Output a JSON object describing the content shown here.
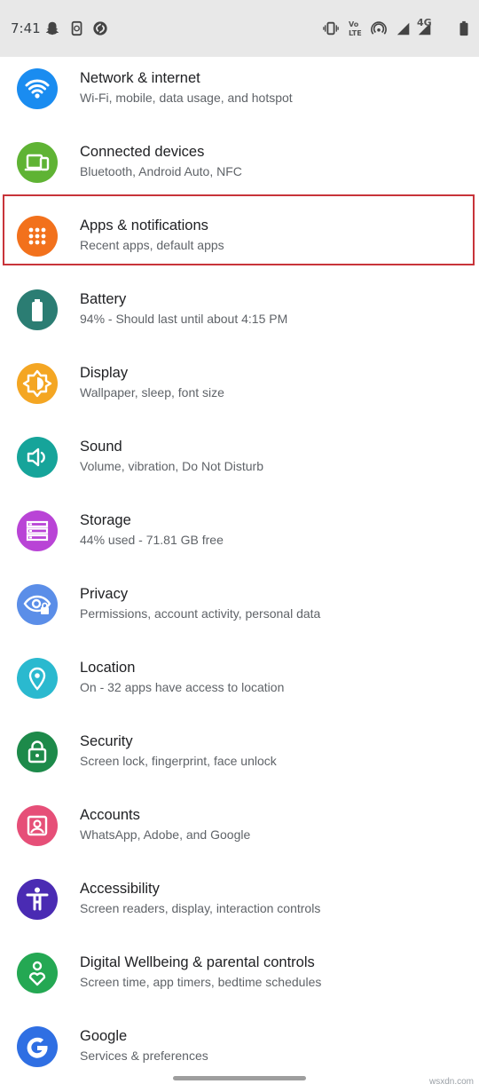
{
  "status_bar": {
    "time": "7:41",
    "left_icons": [
      "snapchat-icon",
      "phone-sync-icon",
      "shazam-icon"
    ],
    "right_icons": [
      "vibrate-icon",
      "volte-icon",
      "hotspot-icon",
      "signal-icon",
      "signal-4g-icon",
      "battery-icon"
    ],
    "volte_label_top": "Vo",
    "volte_label_bottom": "LTE",
    "network_label": "4G"
  },
  "settings": {
    "items": [
      {
        "title": "Network & internet",
        "subtitle": "Wi-Fi, mobile, data usage, and hotspot",
        "icon": "wifi-icon",
        "color": "#1a8cf0"
      },
      {
        "title": "Connected devices",
        "subtitle": "Bluetooth, Android Auto, NFC",
        "icon": "devices-icon",
        "color": "#5fb334"
      },
      {
        "title": "Apps & notifications",
        "subtitle": "Recent apps, default apps",
        "icon": "apps-grid-icon",
        "color": "#f2711c"
      },
      {
        "title": "Battery",
        "subtitle": "94% - Should last until about 4:15 PM",
        "icon": "battery-icon",
        "color": "#2b7d73"
      },
      {
        "title": "Display",
        "subtitle": "Wallpaper, sleep, font size",
        "icon": "brightness-icon",
        "color": "#f4a623"
      },
      {
        "title": "Sound",
        "subtitle": "Volume, vibration, Do Not Disturb",
        "icon": "volume-icon",
        "color": "#16a49a"
      },
      {
        "title": "Storage",
        "subtitle": "44% used - 71.81 GB free",
        "icon": "storage-icon",
        "color": "#b944d6"
      },
      {
        "title": "Privacy",
        "subtitle": "Permissions, account activity, personal data",
        "icon": "privacy-eye-icon",
        "color": "#5b8ee8"
      },
      {
        "title": "Location",
        "subtitle": "On - 32 apps have access to location",
        "icon": "location-pin-icon",
        "color": "#2ab9cf"
      },
      {
        "title": "Security",
        "subtitle": "Screen lock, fingerprint, face unlock",
        "icon": "lock-icon",
        "color": "#1d8a4a"
      },
      {
        "title": "Accounts",
        "subtitle": "WhatsApp, Adobe, and Google",
        "icon": "account-box-icon",
        "color": "#e64f78"
      },
      {
        "title": "Accessibility",
        "subtitle": "Screen readers, display, interaction controls",
        "icon": "accessibility-icon",
        "color": "#4a2bb3"
      },
      {
        "title": "Digital Wellbeing & parental controls",
        "subtitle": "Screen time, app timers, bedtime schedules",
        "icon": "wellbeing-icon",
        "color": "#24a853"
      },
      {
        "title": "Google",
        "subtitle": "Services & preferences",
        "icon": "google-icon",
        "color": "#2f6fe3"
      }
    ],
    "highlighted_index": 2
  },
  "watermark": "wsxdn.com"
}
